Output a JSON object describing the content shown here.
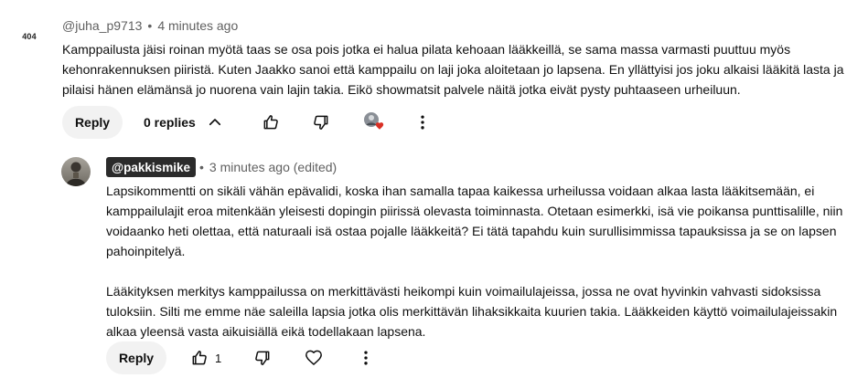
{
  "comment": {
    "avatar_text": "404",
    "username": "@juha_p9713",
    "separator": "•",
    "timestamp": "4 minutes ago",
    "text": "Kamppailusta jäisi roinan myötä taas se osa pois jotka ei halua pilata kehoaan lääkkeillä, se sama massa varmasti puuttuu myös kehonrakennuksen piiristä. Kuten Jaakko sanoi että kamppailu on laji joka aloitetaan jo lapsena. En yllättyisi jos joku alkaisi lääkitä lasta ja pilaisi hänen elämänsä jo nuorena vain lajin takia. Eikö showmatsit palvele näitä jotka eivät pysty puhtaaseen urheiluun.",
    "reply_label": "Reply",
    "replies_label": "0 replies"
  },
  "reply": {
    "username": "@pakkismike",
    "separator": "•",
    "timestamp": "3 minutes ago (edited)",
    "paragraph1": "Lapsikommentti on sikäli vähän epävalidi, koska ihan samalla tapaa kaikessa urheilussa voidaan alkaa lasta lääkitsemään, ei kamppailulajit eroa mitenkään yleisesti dopingin piirissä olevasta toiminnasta. Otetaan esimerkki, isä vie poikansa punttisalille, niin voidaanko heti olettaa, että naturaali isä ostaa pojalle lääkkeitä? Ei tätä tapahdu kuin surullisimmissa tapauksissa ja se on lapsen pahoinpitelyä.",
    "paragraph2": "Lääkityksen merkitys kamppailussa on merkittävästi heikompi kuin voimailulajeissa, jossa ne ovat hyvinkin vahvasti sidoksissa tuloksiin. Silti me emme näe saleilla lapsia jotka olis merkittävän lihaksikkaita kuurien takia. Lääkkeiden käyttö voimailulajeissakin alkaa yleensä vasta aikuisiällä eikä todellakaan lapsena.",
    "reply_label": "Reply",
    "like_count": "1"
  },
  "colors": {
    "heart": "#d93025",
    "badge_bg": "#2b2b2b",
    "button_bg": "#f2f2f2"
  }
}
